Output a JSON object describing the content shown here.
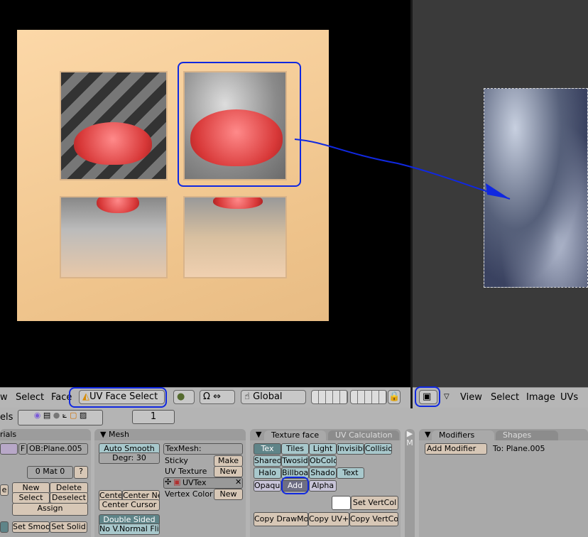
{
  "header3d": {
    "menus": [
      "w",
      "Select",
      "Face"
    ],
    "mode": "UV Face Select",
    "orientation": "Global"
  },
  "headerImg": {
    "menus": [
      "View",
      "Select",
      "Image",
      "UVs"
    ]
  },
  "buttonsBar": {
    "panels_label": "els",
    "frame": "1"
  },
  "materials": {
    "title": "rials",
    "ob": "OB:Plane.005",
    "f": "F",
    "mat": "0 Mat 0",
    "help": "?",
    "new": "New",
    "delete": "Delete",
    "select": "Select",
    "deselect": "Deselect",
    "assign": "Assign",
    "set_smooth": "Set Smoot",
    "set_solid": "Set Solid",
    "e_btn": "e"
  },
  "mesh": {
    "title": "Mesh",
    "auto_smooth": "Auto Smooth",
    "degr": "Degr: 30",
    "texmesh": "TexMesh:",
    "sticky": "Sticky",
    "make": "Make",
    "uv_texture": "UV Texture",
    "new": "New",
    "uvtex": "UVTex",
    "vertex_color": "Vertex Color",
    "new2": "New",
    "cente": "Cente",
    "center_new": "Center Ne",
    "center_cursor": "Center Cursor",
    "double_sided": "Double Sided",
    "no_vnormal_flip": "No V.Normal Flip"
  },
  "textureFace": {
    "tab_active": "Texture face",
    "tab_inactive": "UV Calculation",
    "row1": [
      "Tex",
      "Tiles",
      "Light",
      "Invisibl",
      "Collisio"
    ],
    "row2": [
      "Shared",
      "Twosid",
      "ObColo"
    ],
    "row3": [
      "Halo",
      "Billboar",
      "Shado",
      "Text"
    ],
    "blend": [
      "Opaque",
      "Add",
      "Alpha"
    ],
    "set_vertcol": "Set VertCol",
    "copy": [
      "Copy DrawMo",
      "Copy UV+",
      "Copy VertCol"
    ]
  },
  "side": {
    "label": "M"
  },
  "modifiers": {
    "tab_active": "Modifiers",
    "tab_inactive": "Shapes",
    "add_modifier": "Add Modifier",
    "to": "To: Plane.005"
  },
  "colors": {
    "annotation": "#1028e0",
    "viewport_bg": "#000000",
    "image_editor_bg": "#3a3a3a"
  }
}
